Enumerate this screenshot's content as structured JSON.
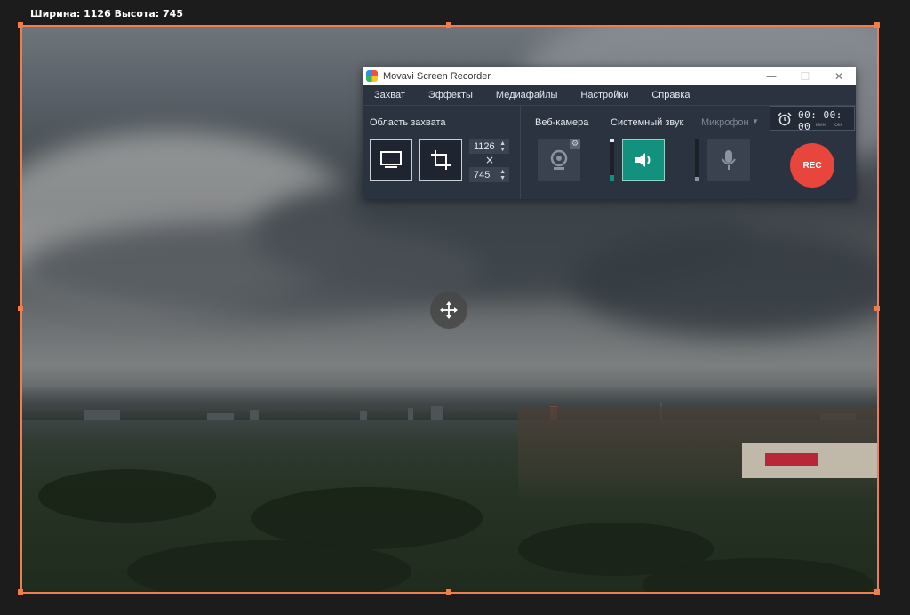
{
  "overlay": {
    "dimensions_label": "Ширина: 1126  Высота: 745"
  },
  "recorder": {
    "title": "Movavi Screen Recorder",
    "window_controls": {
      "minimize": "—",
      "maximize": "☐",
      "close": "✕"
    },
    "menu": [
      "Захват",
      "Эффекты",
      "Медиафайлы",
      "Настройки",
      "Справка"
    ],
    "capture_area": {
      "label": "Область захвата",
      "width": "1126",
      "height": "745",
      "times": "×"
    },
    "webcam": {
      "label": "Веб-камера"
    },
    "system_audio": {
      "label": "Системный звук",
      "level": 0.15
    },
    "microphone": {
      "label": "Микрофон",
      "level": 0.1
    },
    "timer": {
      "time": "00: 00: 00",
      "unit_h": "ч",
      "unit_m": "мин",
      "unit_s": "сек"
    },
    "rec_label": "REC"
  },
  "colors": {
    "selection_frame": "#f07d4d",
    "rec": "#e8453c",
    "audio_active": "#11917e",
    "panel": "#2b3340"
  }
}
